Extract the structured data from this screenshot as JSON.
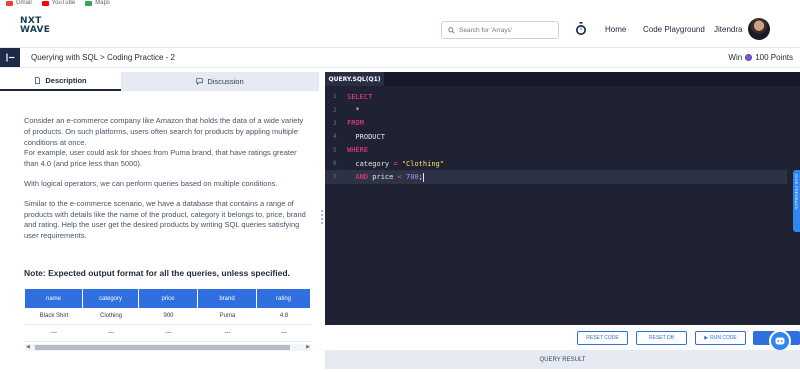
{
  "bookmarks": [
    {
      "label": "Gmail",
      "color": "#ea4335"
    },
    {
      "label": "YouTube",
      "color": "#ff0000"
    },
    {
      "label": "Maps",
      "color": "#34a853"
    }
  ],
  "navbar": {
    "logo_line1": "NXT",
    "logo_line2": "WAVE",
    "search_placeholder": "Search for 'Arrays'",
    "home": "Home",
    "code_playground": "Code Playground",
    "user_name": "Jitendra"
  },
  "breadcrumb": {
    "path": "Querying with SQL > Coding Practice - 2",
    "win_prefix": "Win",
    "points": "100 Points"
  },
  "tabs": {
    "description": "Description",
    "discussion": "Discussion"
  },
  "description": {
    "p1": "Consider an e-commerce company like Amazon that holds the data of a wide variety of products. On such platforms, users often search for products by appling multiple conditions at once.",
    "p2": "For example, user could ask for shoes from Puma brand, that have ratings greater than 4.0 (and price less than 5000).",
    "p3": "With logical operators, we can perform queries based on multiple conditions.",
    "p4": "Similar to the e-commerce scenario, we have a database that contains a range of products with details like the name of the product, category it belongs to, price, brand and rating. Help the user get the desired products by writing SQL queries satisfying user requirements.",
    "note": "Note: Expected output format for all the queries, unless specified."
  },
  "table": {
    "headers": [
      "name",
      "category",
      "price",
      "brand",
      "rating"
    ],
    "rows": [
      [
        "Black Shirt",
        "Clothing",
        "900",
        "Puma",
        "4.8"
      ],
      [
        "---",
        "---",
        "---",
        "---",
        "---"
      ]
    ]
  },
  "editor": {
    "tab": "QUERY.SQL(Q1)",
    "lines": [
      {
        "n": "1",
        "a": "SELECT"
      },
      {
        "n": "2",
        "a": "  *"
      },
      {
        "n": "3",
        "a": "FROM"
      },
      {
        "n": "4",
        "a": "  PRODUCT"
      },
      {
        "n": "5",
        "a": "WHERE"
      },
      {
        "n": "6",
        "a": "  category",
        "b": " = ",
        "c": "\"Clothing\""
      },
      {
        "n": "7",
        "a": "  AND",
        "b": " price ",
        "c": "<",
        "d": " 700",
        "e": ";"
      }
    ]
  },
  "side_tab": "GIVE FEEDBACK",
  "buttons": {
    "reset_code": "RESET CODE",
    "reset_db": "RESET DB",
    "run_code": "RUN CODE",
    "submit": "S"
  },
  "query_result": "QUERY RESULT",
  "colors": {
    "primary": "#2f6fe0",
    "editor_bg": "#1f2233",
    "keyword": "#ff3f7f",
    "string": "#ffe066",
    "number": "#b58cff"
  }
}
